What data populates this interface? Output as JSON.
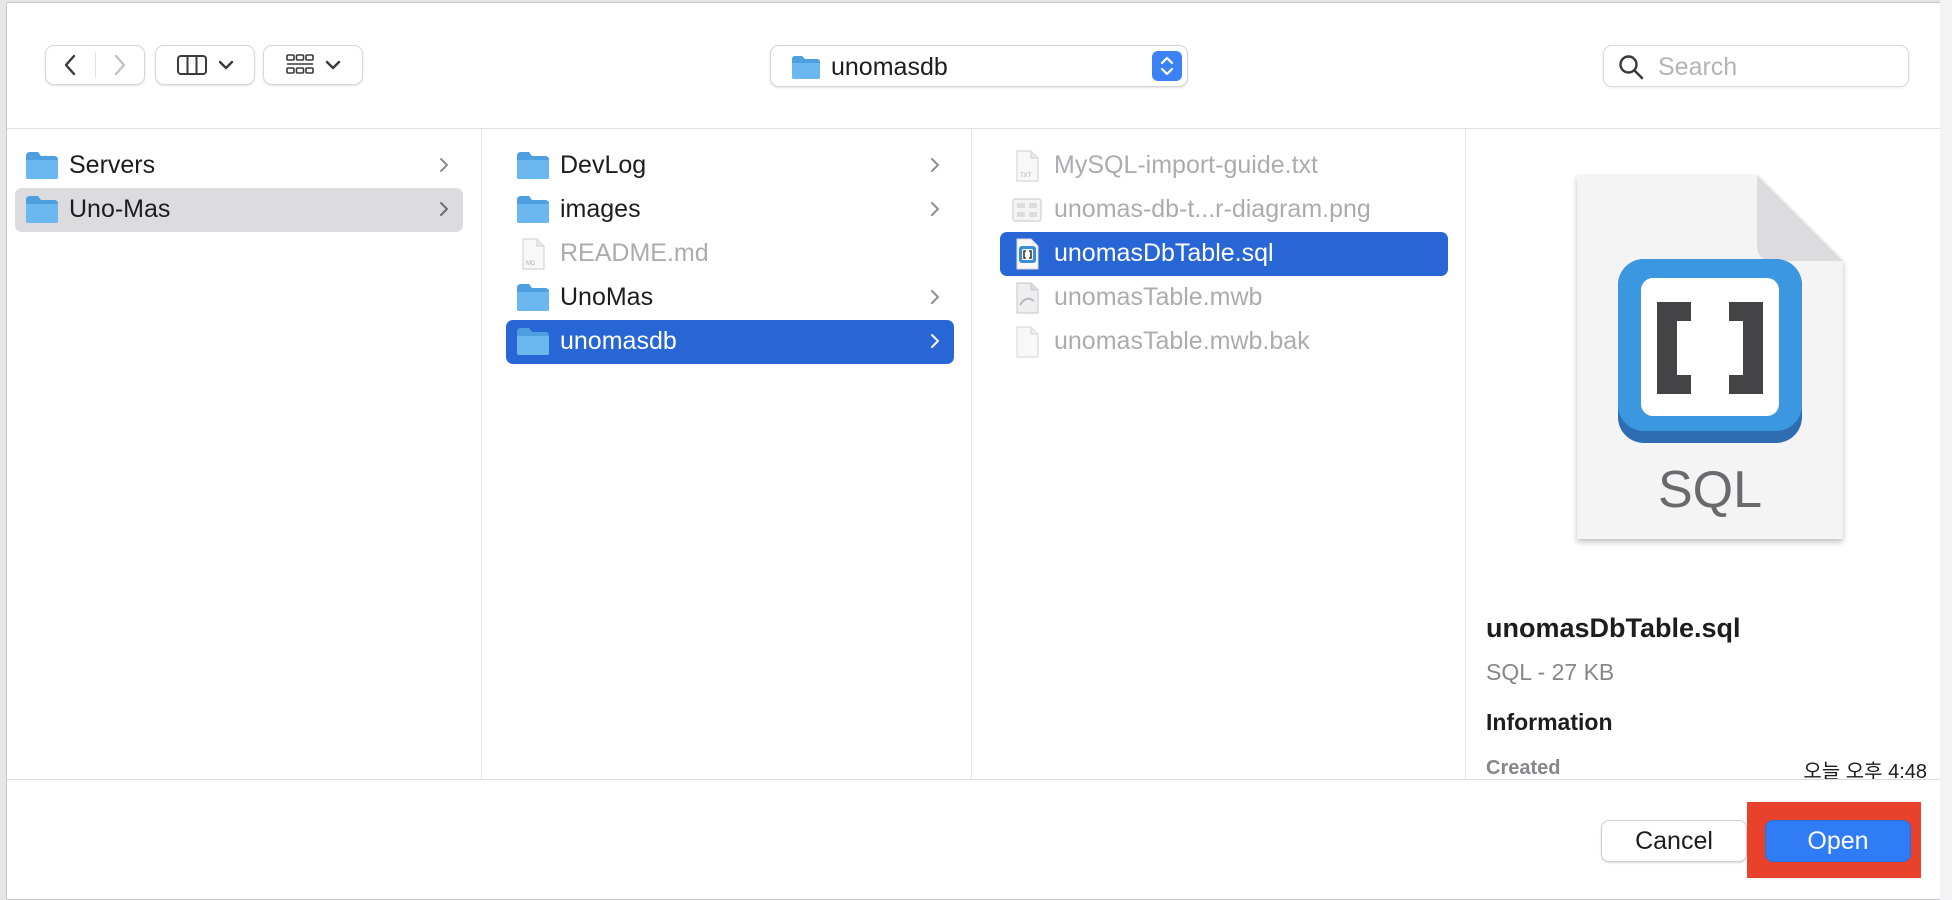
{
  "toolbar": {
    "path_label": "unomasdb",
    "search_placeholder": "Search"
  },
  "columns": {
    "col1": [
      {
        "label": "Servers",
        "type": "folder",
        "chevron": true,
        "state": "normal"
      },
      {
        "label": "Uno-Mas",
        "type": "folder",
        "chevron": true,
        "state": "selected-inactive"
      }
    ],
    "col2": [
      {
        "label": "DevLog",
        "type": "folder",
        "chevron": true,
        "state": "normal"
      },
      {
        "label": "images",
        "type": "folder",
        "chevron": true,
        "state": "normal"
      },
      {
        "label": "README.md",
        "type": "file",
        "chevron": false,
        "state": "disabled"
      },
      {
        "label": "UnoMas",
        "type": "folder",
        "chevron": true,
        "state": "normal"
      },
      {
        "label": "unomasdb",
        "type": "folder",
        "chevron": true,
        "state": "selected"
      }
    ],
    "col3": [
      {
        "label": "MySQL-import-guide.txt",
        "type": "file",
        "state": "disabled"
      },
      {
        "label": "unomas-db-t...r-diagram.png",
        "type": "file",
        "state": "disabled"
      },
      {
        "label": "unomasDbTable.sql",
        "type": "sql",
        "state": "selected"
      },
      {
        "label": "unomasTable.mwb",
        "type": "file",
        "state": "disabled"
      },
      {
        "label": "unomasTable.mwb.bak",
        "type": "file",
        "state": "disabled"
      }
    ]
  },
  "preview": {
    "icon_label": "SQL",
    "file_name": "unomasDbTable.sql",
    "kind_size": "SQL - 27 KB",
    "info_heading": "Information",
    "created_label": "Created",
    "created_value": "오늘 오후 4:48"
  },
  "footer": {
    "cancel_label": "Cancel",
    "open_label": "Open"
  },
  "colors": {
    "selection_blue": "#2866d6",
    "folder_blue": "#5aaee8",
    "highlight_red": "#e8412c"
  }
}
